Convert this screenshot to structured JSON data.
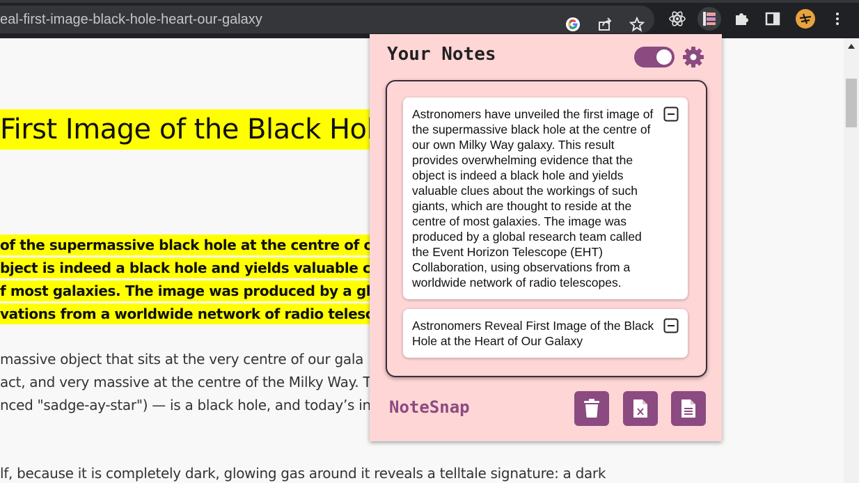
{
  "browser": {
    "url_text": "eal-first-image-black-hole-heart-our-galaxy"
  },
  "article": {
    "headline": "First Image of the Black Hol",
    "highlighted_lines": [
      " of the supermassive black hole at the centre of our o",
      "bject is indeed a black hole and yields valuable clues",
      "f most galaxies. The image was produced by a global",
      "vations from a worldwide network of radio telescope"
    ],
    "body_lines": [
      " massive object that sits at the very centre of our gala",
      "act, and very massive at the centre of the Milky Way. T",
      "nced \"sadge-ay-star\") — is a black hole, and today’s in",
      "lf, because it is completely dark, glowing gas around it reveals a telltale signature: a dark"
    ]
  },
  "popup": {
    "title": "Your Notes",
    "toggle_on": true,
    "notes": [
      {
        "text": "Astronomers have unveiled the first image of the supermassive black hole at the centre of our own Milky Way galaxy. This result provides overwhelming evidence that the object is indeed a black hole and yields valuable clues about the workings of such giants, which are thought to reside at the centre of most galaxies. The image was produced by a global research team called the Event Horizon Telescope (EHT) Collaboration, using observations from a worldwide network of radio telescopes."
      },
      {
        "text": "Astronomers Reveal First Image of the Black Hole at the Heart of Our Galaxy"
      }
    ],
    "footer_title": "NoteSnap",
    "footer_buttons": [
      "trash-icon",
      "excel-export-icon",
      "document-export-icon"
    ]
  },
  "colors": {
    "popup_bg": "#ffd6d6",
    "accent": "#8b4a80",
    "highlight": "#ffff00"
  }
}
